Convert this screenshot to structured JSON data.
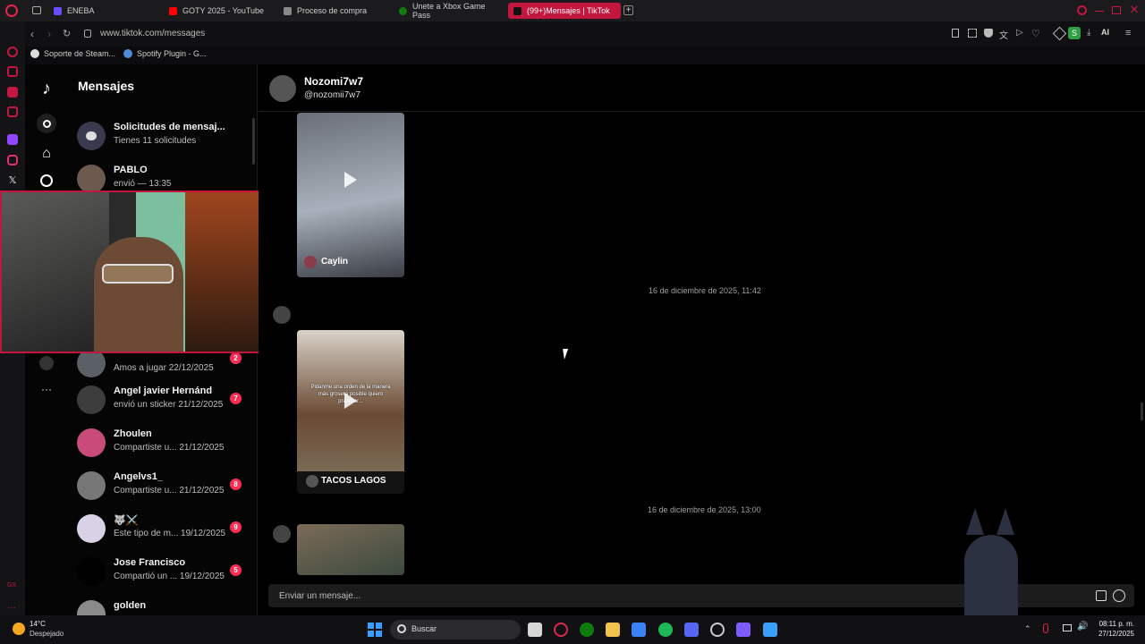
{
  "browser": {
    "tabs": [
      {
        "label": "ENEBA",
        "color": "#6a4cff"
      },
      {
        "label": "GOTY 2025 - YouTube",
        "color": "#ff0000"
      },
      {
        "label": "Proceso de compra",
        "color": "#8a8a8a"
      },
      {
        "label": "Únete a Xbox Game Pass",
        "color": "#107c10"
      },
      {
        "label": "(99+)Mensajes | TikTok",
        "color": "#111111"
      }
    ],
    "url": "www.tiktok.com/messages",
    "bookmarks": [
      {
        "label": "Soporte de Steam..."
      },
      {
        "label": "Spotify Plugin - G..."
      }
    ],
    "toolbar_ai": "AI",
    "profile_letter": "S"
  },
  "tiktok": {
    "header": "Mensajes",
    "requests": {
      "name": "Solicitudes de mensaj...",
      "preview": "Tienes 11 solicitudes"
    },
    "conversations": [
      {
        "name": "PABLO",
        "preview": "envió — 13:35",
        "badge": ""
      },
      {
        "name": "",
        "preview": "Amos a jugar 22/12/2025",
        "badge": "2"
      },
      {
        "name": "Angel javier Hernánd",
        "preview": "envió un sticker 21/12/2025",
        "badge": "7"
      },
      {
        "name": "Zhoulen",
        "preview": "Compartiste u...   21/12/2025",
        "badge": ""
      },
      {
        "name": "Angelvs1_",
        "preview": "Compartiste u...   21/12/2025",
        "badge": "8"
      },
      {
        "name": "🐺⚔️",
        "preview": "Este tipo de m...   19/12/2025",
        "badge": "9"
      },
      {
        "name": "Jose Francisco",
        "preview": "Compartió un ...   19/12/2025",
        "badge": "5"
      },
      {
        "name": "golden",
        "preview": "",
        "badge": ""
      }
    ],
    "chat": {
      "name": "Nozomi7w7",
      "handle": "@nozomii7w7",
      "messages": [
        {
          "author": "Caylin"
        },
        {
          "timestamp": "16 de diciembre de 2025, 11:42",
          "author": "TACOS LAGOS",
          "caption": "Pidanme una orden de la manera más grosera posible quiero practicar..."
        },
        {
          "timestamp": "16 de diciembre de 2025, 13:00"
        }
      ],
      "input_placeholder": "Enviar un mensaje..."
    }
  },
  "taskbar": {
    "weather_temp": "14°C",
    "weather_desc": "Despejado",
    "search_label": "Buscar",
    "time": "08:11 p. m.",
    "date": "27/12/2025"
  }
}
